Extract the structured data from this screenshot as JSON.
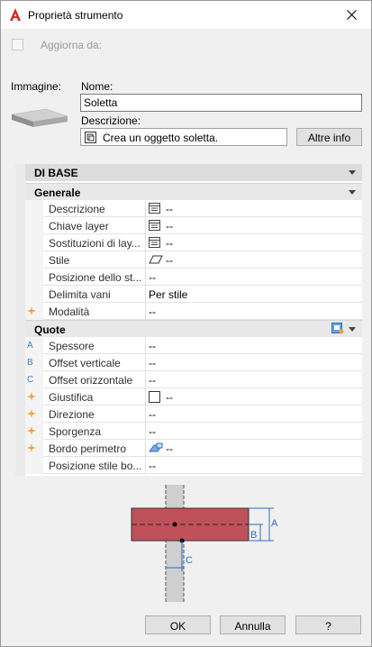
{
  "window": {
    "title": "Proprietà strumento"
  },
  "update": {
    "label": "Aggiorna da:"
  },
  "image_label": "Immagine:",
  "name": {
    "label": "Nome:",
    "value": "Soletta"
  },
  "description": {
    "label": "Descrizione:",
    "value": "Crea un oggetto soletta.",
    "more_button": "Altre info"
  },
  "grid": {
    "category": "DI BASE",
    "general_header": "Generale",
    "general_rows": [
      {
        "name": "Descrizione",
        "value": "--",
        "icon": "table-icon"
      },
      {
        "name": "Chiave layer",
        "value": "--",
        "icon": "table-icon"
      },
      {
        "name": "Sostituzioni di lay...",
        "value": "--",
        "icon": "table-icon"
      },
      {
        "name": "Stile",
        "value": "--",
        "icon": "slab-style-icon"
      },
      {
        "name": "Posizione dello st...",
        "value": "--"
      },
      {
        "name": "Delimita vani",
        "value": "Per stile"
      },
      {
        "name": "Modalità",
        "value": "--",
        "gutter": "star"
      }
    ],
    "quote_header": "Quote",
    "quote_rows": [
      {
        "name": "Spessore",
        "value": "--",
        "gutter": "A"
      },
      {
        "name": "Offset verticale",
        "value": "--",
        "gutter": "B"
      },
      {
        "name": "Offset orizzontale",
        "value": "--",
        "gutter": "C"
      },
      {
        "name": "Giustifica",
        "value": "--",
        "gutter": "star",
        "icon": "checkbox-icon"
      },
      {
        "name": "Direzione",
        "value": "--",
        "gutter": "star"
      },
      {
        "name": "Sporgenza",
        "value": "--",
        "gutter": "star"
      },
      {
        "name": "Bordo perimetro",
        "value": "--",
        "gutter": "star",
        "icon": "edge-icon"
      },
      {
        "name": "Posizione stile bo...",
        "value": "--"
      }
    ]
  },
  "diagram": {
    "label_a": "A",
    "label_b": "B",
    "label_c": "C"
  },
  "buttons": {
    "ok": "OK",
    "cancel": "Annulla",
    "help": "?"
  },
  "colors": {
    "slab": "#c0505a",
    "accent": "#2e6cc9"
  }
}
